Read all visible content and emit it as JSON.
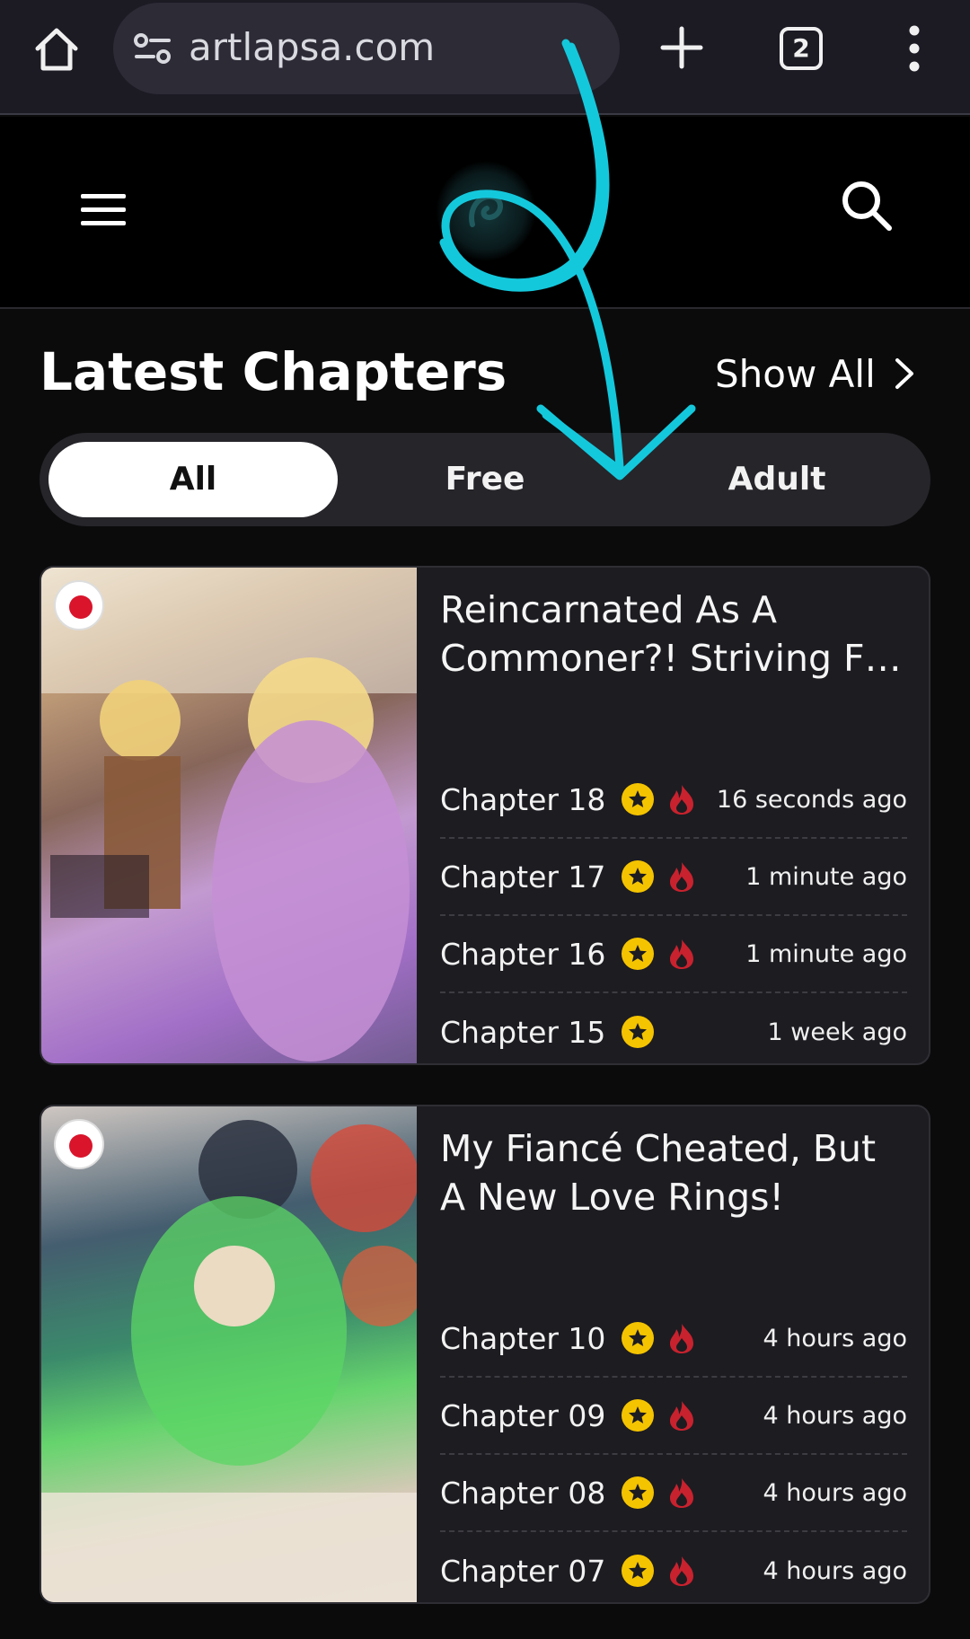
{
  "browser": {
    "url": "artlapsa.com",
    "tab_count": "2",
    "icons": [
      "home-icon",
      "site-info-icon",
      "new-tab-icon",
      "tab-switcher-icon",
      "overflow-menu-icon"
    ]
  },
  "header": {
    "icons": [
      "hamburger-menu-icon",
      "site-logo",
      "search-icon"
    ]
  },
  "section": {
    "title": "Latest Chapters",
    "show_all": "Show All"
  },
  "filters": {
    "tabs": [
      {
        "label": "All",
        "active": true
      },
      {
        "label": "Free",
        "active": false
      },
      {
        "label": "Adult",
        "active": false
      }
    ]
  },
  "cards": [
    {
      "title": "Reincarnated As A Commoner?! Striving F…",
      "chapters": [
        {
          "label": "Chapter 18",
          "premium": true,
          "hot": true,
          "time": "16 seconds ago"
        },
        {
          "label": "Chapter 17",
          "premium": true,
          "hot": true,
          "time": "1 minute ago"
        },
        {
          "label": "Chapter 16",
          "premium": true,
          "hot": true,
          "time": "1 minute ago"
        },
        {
          "label": "Chapter 15",
          "premium": true,
          "hot": false,
          "time": "1 week ago"
        }
      ]
    },
    {
      "title": "My Fiancé Cheated, But A New Love Rings!",
      "chapters": [
        {
          "label": "Chapter 10",
          "premium": true,
          "hot": true,
          "time": "4 hours ago"
        },
        {
          "label": "Chapter 09",
          "premium": true,
          "hot": true,
          "time": "4 hours ago"
        },
        {
          "label": "Chapter 08",
          "premium": true,
          "hot": true,
          "time": "4 hours ago"
        },
        {
          "label": "Chapter 07",
          "premium": true,
          "hot": true,
          "time": "4 hours ago"
        }
      ]
    }
  ],
  "colors": {
    "background": "#0b0b0c",
    "card": "#1d1c21",
    "star": "#f5c400",
    "fire": "#c8222e",
    "annotation": "#14c8dc"
  }
}
